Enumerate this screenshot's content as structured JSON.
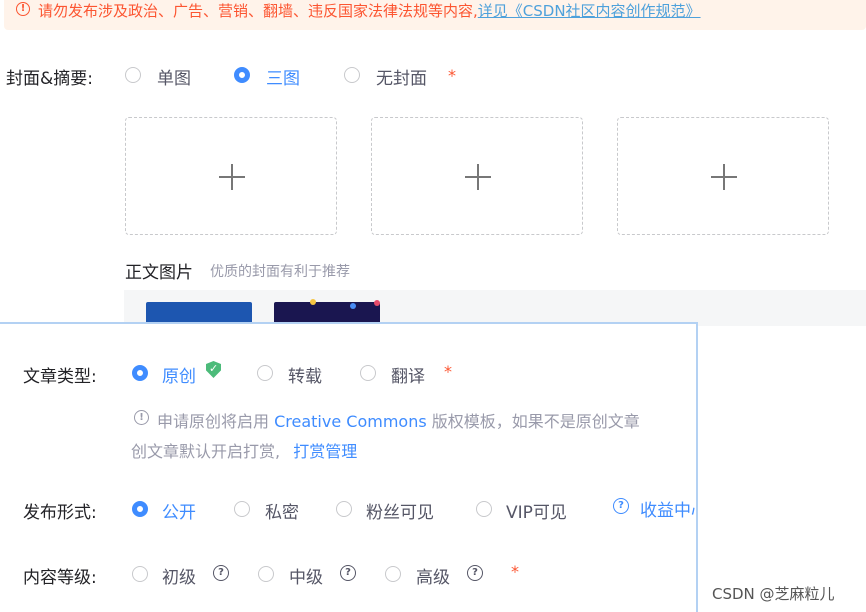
{
  "notice": {
    "text": "请勿发布涉及政治、广告、营销、翻墙、违反国家法律法规等内容,",
    "link": "详见《CSDN社区内容创作规范》"
  },
  "cover": {
    "label": "封面&摘要:",
    "options": [
      "单图",
      "三图",
      "无封面"
    ],
    "selected": "三图",
    "slots": 3,
    "body_images_title": "正文图片",
    "body_images_hint": "优质的封面有利于推荐"
  },
  "article_type": {
    "label": "文章类型:",
    "options": [
      "原创",
      "转载",
      "翻译"
    ],
    "selected": "原创",
    "hint_prefix": "申请原创将启用",
    "hint_link": "Creative Commons",
    "hint_suffix": "版权模板，如果不是原创文章",
    "hint_line2": "创文章默认开启打赏,",
    "hint_link2": "打赏管理"
  },
  "publish": {
    "label": "发布形式:",
    "options": [
      "公开",
      "私密",
      "粉丝可见",
      "VIP可见"
    ],
    "selected": "公开",
    "extra_link": "收益中心"
  },
  "level": {
    "label": "内容等级:",
    "options": [
      "初级",
      "中级",
      "高级"
    ]
  },
  "required_mark": "*",
  "help_icon_glyph": "?",
  "info_icon_glyph": "!",
  "watermark": "CSDN @芝麻粒儿",
  "colors": {
    "accent": "#3f8cff",
    "danger": "#fc5531",
    "original_badge": "#4cbb7a"
  }
}
